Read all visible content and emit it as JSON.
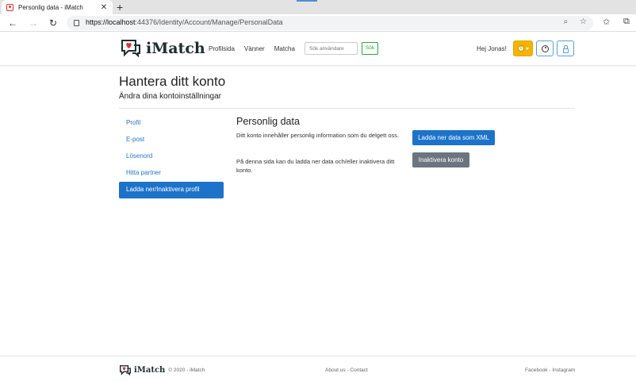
{
  "browser": {
    "tab_title": "Personlig data - iMatch",
    "tab_close": "✕",
    "new_tab": "+",
    "url_host": "https://localhost",
    "url_path": ":44376/Identity/Account/Manage/PersonalData"
  },
  "header": {
    "brand": "iMatch",
    "nav": [
      "Profilsida",
      "Vänner",
      "Matcha"
    ],
    "search_placeholder": "Sök användare",
    "search_button": "Sök",
    "greeting": "Hej Jonas!",
    "coin_label": "0"
  },
  "main": {
    "title": "Hantera ditt konto",
    "subtitle": "Ändra dina kontoinställningar",
    "sidenav": [
      "Profil",
      "E-post",
      "Lösenord",
      "Hitta partner",
      "Ladda ner/Inaktivera profil"
    ],
    "content_title": "Personlig data",
    "paragraph1": "Ditt konto innehåller personlig information som du delgett oss.",
    "paragraph2": "På denna sida kan du ladda ner data och/eller inaktivera ditt konto.",
    "download_button": "Ladda ner data som XML",
    "deactivate_button": "Inaktivera konto"
  },
  "footer": {
    "brand": "iMatch",
    "copyright": "© 2020 - iMatch",
    "center_links": "About us - Contact",
    "right_links": "Facebook - Instagram"
  },
  "colors": {
    "primary": "#1c73c9",
    "secondary": "#6c757d",
    "success": "#28a745",
    "warning": "#f4b400",
    "heart": "#d33"
  }
}
